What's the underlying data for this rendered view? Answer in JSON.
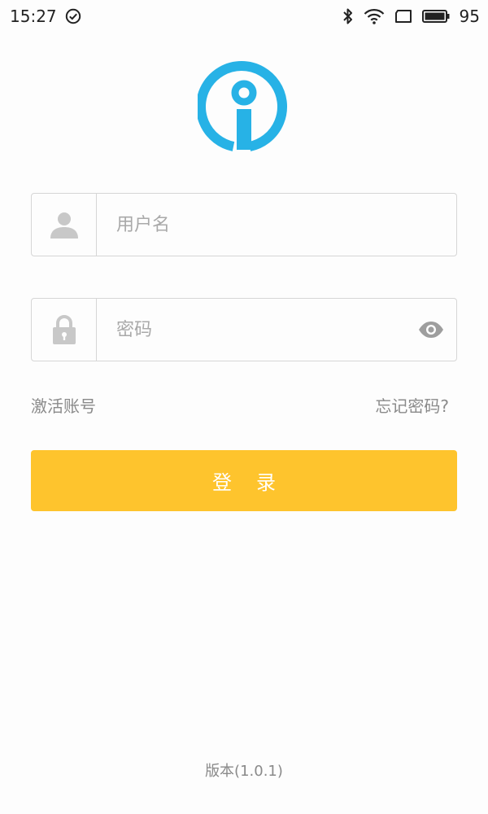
{
  "status_bar": {
    "time": "15:27",
    "battery_level": "95",
    "icons": [
      "check-circle-icon",
      "bluetooth-icon",
      "wifi-icon",
      "screen-icon",
      "battery-icon"
    ]
  },
  "logo": {
    "icon": "info-logo-icon",
    "color": "#27b2e6"
  },
  "username": {
    "placeholder": "用户名",
    "value": "",
    "icon": "user-icon"
  },
  "password": {
    "placeholder": "密码",
    "value": "",
    "icon": "lock-icon",
    "toggle_icon": "eye-icon"
  },
  "links": {
    "activate": "激活账号",
    "forgot": "忘记密码?"
  },
  "login_button": {
    "label": "登录",
    "color": "#fec42d"
  },
  "footer": {
    "version": "版本(1.0.1)"
  }
}
